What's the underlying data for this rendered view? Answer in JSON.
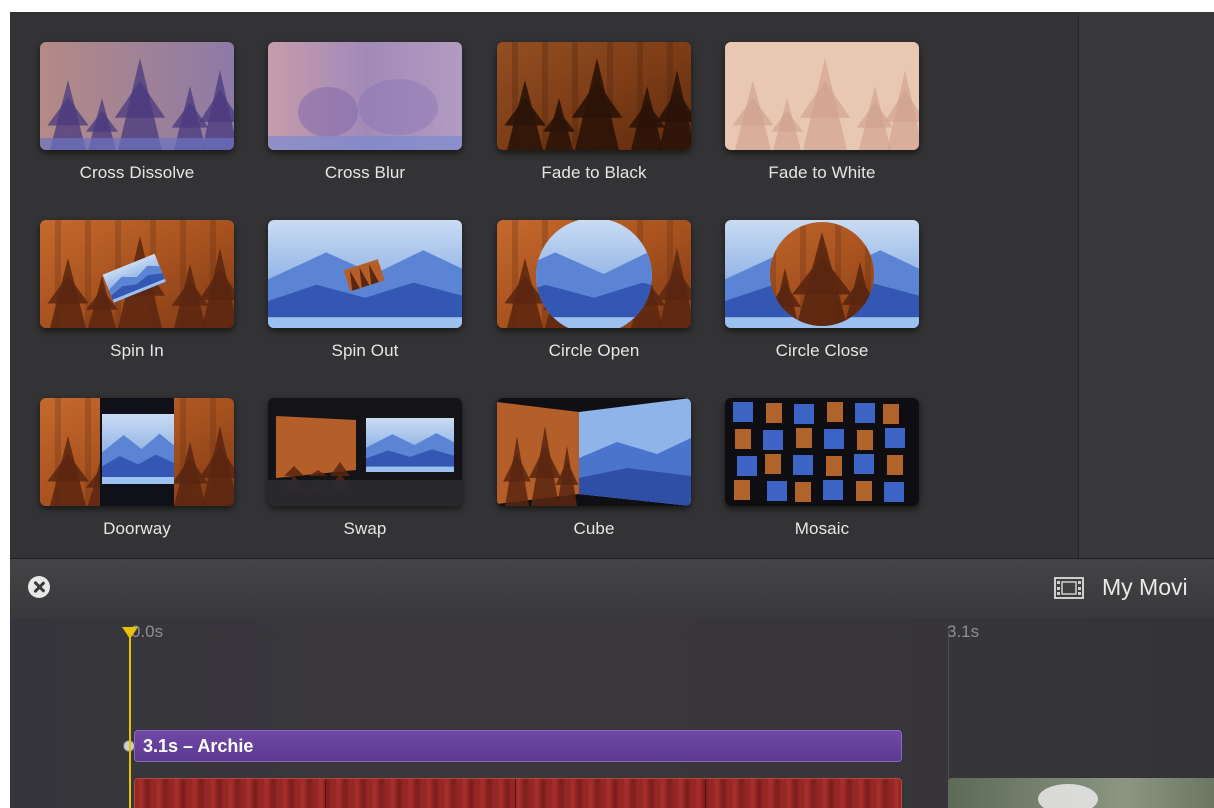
{
  "transitions": [
    {
      "label": "Cross Dissolve",
      "icon": "cross-dissolve-thumbnail"
    },
    {
      "label": "Cross Blur",
      "icon": "cross-blur-thumbnail"
    },
    {
      "label": "Fade to Black",
      "icon": "fade-to-black-thumbnail"
    },
    {
      "label": "Fade to White",
      "icon": "fade-to-white-thumbnail"
    },
    {
      "label": "Spin In",
      "icon": "spin-in-thumbnail"
    },
    {
      "label": "Spin Out",
      "icon": "spin-out-thumbnail"
    },
    {
      "label": "Circle Open",
      "icon": "circle-open-thumbnail"
    },
    {
      "label": "Circle Close",
      "icon": "circle-close-thumbnail"
    },
    {
      "label": "Doorway",
      "icon": "doorway-thumbnail"
    },
    {
      "label": "Swap",
      "icon": "swap-thumbnail"
    },
    {
      "label": "Cube",
      "icon": "cube-thumbnail"
    },
    {
      "label": "Mosaic",
      "icon": "mosaic-thumbnail"
    }
  ],
  "toolbar": {
    "close_icon": "close-circle-icon",
    "project_icon": "filmstrip-icon",
    "project_title": "My Movi"
  },
  "timeline": {
    "ruler": [
      "0.0s",
      "3.1s"
    ],
    "title_clip": "3.1s – Archie",
    "playhead_color": "#e6c200",
    "title_clip_color": "#6a44a0",
    "video_clip_color": "#9b2a27"
  },
  "colors": {
    "background": "#2f2f31",
    "forest": "#b45e2a",
    "mountain": "#3e6bc8"
  }
}
